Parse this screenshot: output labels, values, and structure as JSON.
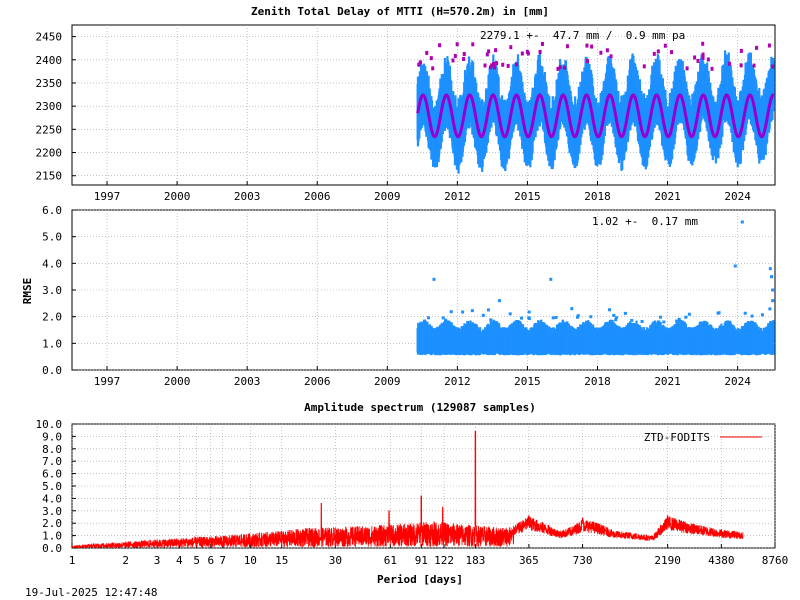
{
  "footer": {
    "timestamp": "19-Jul-2025 12:47:48"
  },
  "colors": {
    "data": "#1e90ff",
    "model": "#9400d3",
    "outlier": "#b000b0",
    "spectrum": "#ff0000",
    "grid": "#a0a0a0"
  },
  "chart_data": [
    {
      "type": "scatter",
      "title": "Zenith Total Delay of MTTI (H=570.2m) in [mm]",
      "annotation": "2279.1 +-  47.7 mm /  0.9 mm pa",
      "xlabel": "",
      "ylabel": "",
      "xlim": [
        1995.5,
        2025.6
      ],
      "ylim": [
        2130,
        2475
      ],
      "xticks": [
        1997,
        2000,
        2003,
        2006,
        2009,
        2012,
        2015,
        2018,
        2021,
        2024
      ],
      "yticks": [
        2150,
        2200,
        2250,
        2300,
        2350,
        2400,
        2450
      ],
      "grid": true,
      "data_start": 2010.3,
      "data_end": 2025.55,
      "series": [
        {
          "kind": "observations",
          "mean": 2279.1,
          "annual_amplitude": 48,
          "band_low": 2170,
          "band_high": 2420,
          "trend_per_year": 0.9
        },
        {
          "kind": "seasonal-model",
          "mean": 2279.1,
          "annual_amplitude": 45
        }
      ]
    },
    {
      "type": "scatter",
      "title": "",
      "annotation": "1.02 +-  0.17 mm",
      "xlabel": "",
      "ylabel": "RMSE",
      "xlim": [
        1995.5,
        2025.6
      ],
      "ylim": [
        0,
        6
      ],
      "xticks": [
        1997,
        2000,
        2003,
        2006,
        2009,
        2012,
        2015,
        2018,
        2021,
        2024
      ],
      "yticks": [
        "0.0",
        "1.0",
        "2.0",
        "3.0",
        "4.0",
        "5.0",
        "6.0"
      ],
      "grid": true,
      "data_start": 2010.3,
      "data_end": 2025.55,
      "typical_range": [
        0.6,
        1.8
      ],
      "outliers": [
        [
          2011.0,
          3.4
        ],
        [
          2013.8,
          2.6
        ],
        [
          2016.0,
          3.4
        ],
        [
          2016.9,
          2.3
        ],
        [
          2023.9,
          3.9
        ],
        [
          2024.2,
          5.55
        ],
        [
          2025.4,
          3.8
        ],
        [
          2025.45,
          3.5
        ],
        [
          2025.5,
          3.0
        ],
        [
          2025.5,
          2.6
        ]
      ]
    },
    {
      "type": "line",
      "title": "Amplitude spectrum (129087 samples)",
      "xlabel": "Period [days]",
      "ylabel": "",
      "x_scale": "log",
      "xlim": [
        1,
        8760
      ],
      "ylim": [
        0,
        10
      ],
      "xticks": [
        1,
        2,
        3,
        4,
        5,
        6,
        7,
        10,
        15,
        30,
        61,
        91,
        122,
        183,
        365,
        730,
        2190,
        4380,
        8760
      ],
      "yticks": [
        "0.0",
        "1.0",
        "2.0",
        "3.0",
        "4.0",
        "5.0",
        "6.0",
        "7.0",
        "8.0",
        "9.0",
        "10.0"
      ],
      "grid": true,
      "legend": {
        "label": "ZTD-FODITS",
        "position": "top-right"
      },
      "series": [
        {
          "name": "ZTD-FODITS",
          "peaks": [
            [
              183,
              9.4
            ],
            [
              91,
              4.2
            ],
            [
              120,
              3.3
            ],
            [
              25,
              3.6
            ],
            [
              60,
              3.0
            ],
            [
              365,
              2.6
            ],
            [
              730,
              2.4
            ],
            [
              2190,
              2.6
            ]
          ],
          "points": [
            [
              1,
              0.2
            ],
            [
              1.2,
              0.3
            ],
            [
              1.5,
              0.4
            ],
            [
              2,
              0.5
            ],
            [
              2.5,
              0.6
            ],
            [
              3,
              0.7
            ],
            [
              4,
              0.8
            ],
            [
              5,
              0.9
            ],
            [
              7,
              1.0
            ],
            [
              10,
              1.2
            ],
            [
              15,
              1.4
            ],
            [
              20,
              1.6
            ],
            [
              30,
              1.7
            ],
            [
              45,
              1.8
            ],
            [
              61,
              1.9
            ],
            [
              80,
              2.0
            ],
            [
              100,
              2.2
            ],
            [
              140,
              2.0
            ],
            [
              200,
              1.8
            ],
            [
              250,
              1.7
            ],
            [
              300,
              1.8
            ],
            [
              365,
              2.6
            ],
            [
              450,
              2.0
            ],
            [
              550,
              1.4
            ],
            [
              650,
              1.8
            ],
            [
              730,
              2.4
            ],
            [
              900,
              2.0
            ],
            [
              1100,
              1.4
            ],
            [
              1500,
              1.2
            ],
            [
              1800,
              1.0
            ],
            [
              2190,
              2.6
            ],
            [
              3000,
              2.0
            ],
            [
              4380,
              1.5
            ],
            [
              5800,
              1.3
            ]
          ]
        }
      ]
    }
  ]
}
